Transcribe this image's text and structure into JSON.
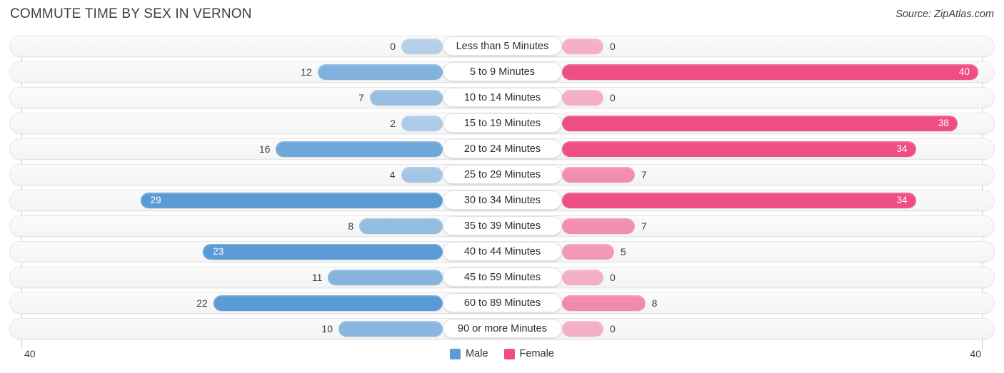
{
  "header": {
    "title": "COMMUTE TIME BY SEX IN VERNON",
    "source": "Source: ZipAtlas.com"
  },
  "legend": {
    "items": [
      {
        "label": "Male",
        "color": "#5b9bd5"
      },
      {
        "label": "Female",
        "color": "#ef4e84"
      }
    ]
  },
  "axis": {
    "left_tick": "40",
    "right_tick": "40",
    "max": 40
  },
  "chart_data": {
    "type": "bar",
    "subtype": "diverging-horizontal",
    "title": "COMMUTE TIME BY SEX IN VERNON",
    "xlabel": "",
    "ylabel": "",
    "xlim": [
      40,
      40
    ],
    "grid": false,
    "legend_position": "bottom-center",
    "categories": [
      "Less than 5 Minutes",
      "5 to 9 Minutes",
      "10 to 14 Minutes",
      "15 to 19 Minutes",
      "20 to 24 Minutes",
      "25 to 29 Minutes",
      "30 to 34 Minutes",
      "35 to 39 Minutes",
      "40 to 44 Minutes",
      "45 to 59 Minutes",
      "60 to 89 Minutes",
      "90 or more Minutes"
    ],
    "series": [
      {
        "name": "Male",
        "color": "#5b9bd5",
        "direction": "left",
        "values": [
          0,
          12,
          7,
          2,
          16,
          4,
          29,
          8,
          23,
          11,
          22,
          10
        ]
      },
      {
        "name": "Female",
        "color": "#ef4e84",
        "direction": "right",
        "values": [
          0,
          40,
          0,
          38,
          34,
          7,
          34,
          7,
          5,
          0,
          8,
          0
        ]
      }
    ]
  }
}
